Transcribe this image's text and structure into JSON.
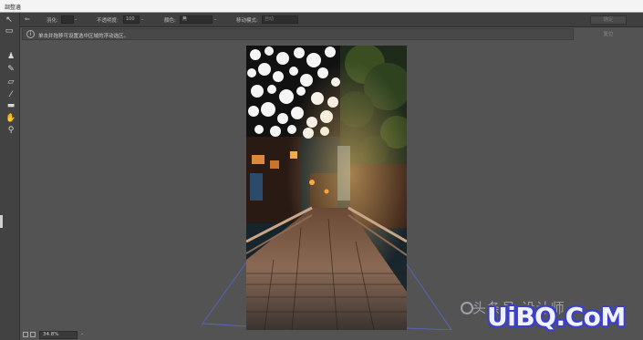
{
  "titlebar": {
    "title": "調整邊"
  },
  "options": {
    "feather_label": "羽化:",
    "feather_value": "",
    "opacity_label": "不透明度:",
    "opacity_value": "100",
    "color_label": "顏色:",
    "color_value": "無",
    "move_mode_label": "移动模式:",
    "move_mode_value": "自动",
    "right_button": "确定"
  },
  "hint": {
    "text": "单击并拖移可设置选中区域的浮动选区。",
    "reset_label": "复位"
  },
  "status": {
    "zoom": "34.8%"
  },
  "watermark": {
    "cn": "头条号·设计师",
    "en": "UiBQ.CoM"
  },
  "colors": {
    "canvas_bg": "#535353",
    "panel": "#424242",
    "watermark_blue": "#3b40c8"
  },
  "icons": {
    "tools": [
      "move-icon",
      "rect-select-icon",
      "person-icon",
      "brush-icon",
      "eraser-icon",
      "eyedropper-icon",
      "ruler-icon",
      "hand-icon",
      "zoom-icon"
    ]
  }
}
